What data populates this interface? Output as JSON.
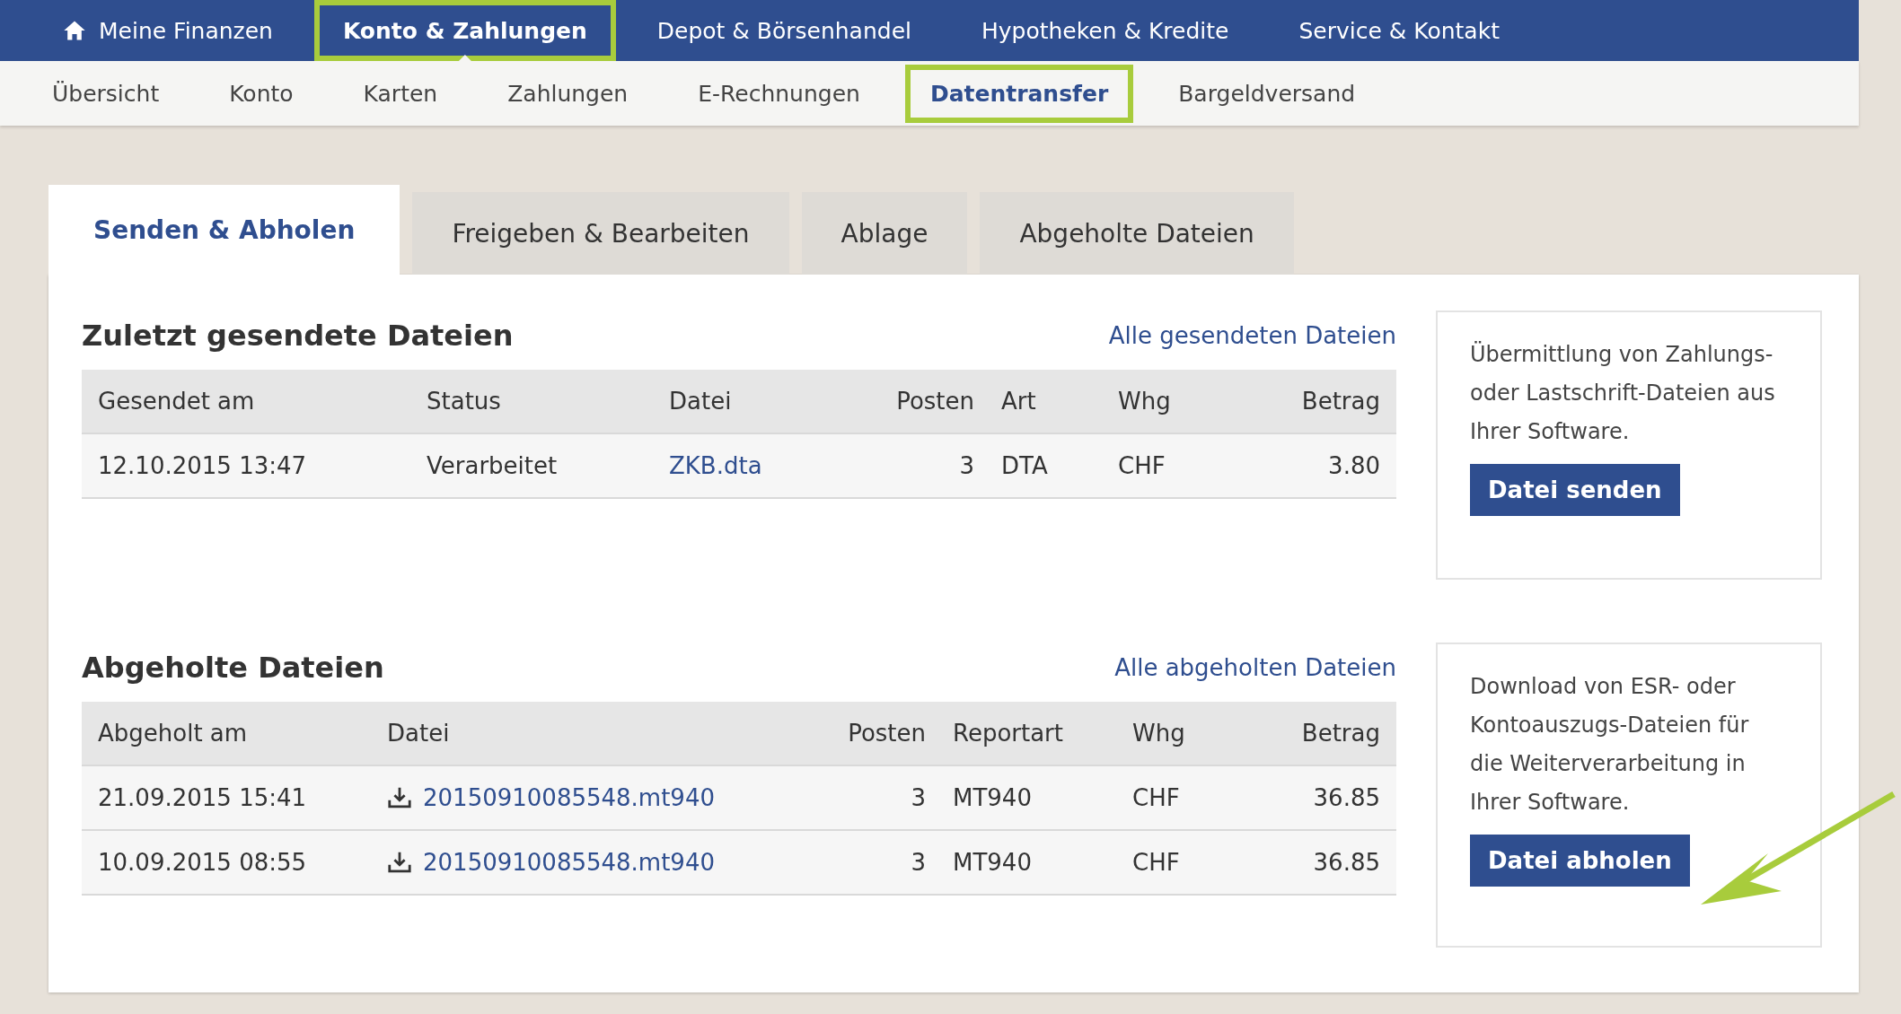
{
  "main_nav": [
    {
      "label": "Meine Finanzen",
      "kind": "home",
      "selected": false
    },
    {
      "label": "Konto & Zahlungen",
      "kind": "plain",
      "selected": true
    },
    {
      "label": "Depot & Börsenhandel",
      "kind": "plain",
      "selected": false
    },
    {
      "label": "Hypotheken & Kredite",
      "kind": "plain",
      "selected": false
    },
    {
      "label": "Service & Kontakt",
      "kind": "plain",
      "selected": false
    }
  ],
  "sub_nav": [
    {
      "label": "Übersicht",
      "selected": false
    },
    {
      "label": "Konto",
      "selected": false
    },
    {
      "label": "Karten",
      "selected": false
    },
    {
      "label": "Zahlungen",
      "selected": false
    },
    {
      "label": "E-Rechnungen",
      "selected": false
    },
    {
      "label": "Datentransfer",
      "selected": true
    },
    {
      "label": "Bargeldversand",
      "selected": false
    }
  ],
  "tabs": [
    {
      "label": "Senden & Abholen",
      "selected": true
    },
    {
      "label": "Freigeben & Bearbeiten",
      "selected": false
    },
    {
      "label": "Ablage",
      "selected": false
    },
    {
      "label": "Abgeholte Dateien",
      "selected": false
    }
  ],
  "sections": [
    {
      "title": "Zuletzt gesendete Dateien",
      "link": "Alle gesendeten Dateien",
      "columns": [
        {
          "label": "Gesendet am",
          "kind": "text"
        },
        {
          "label": "Status",
          "kind": "text"
        },
        {
          "label": "Datei",
          "kind": "link"
        },
        {
          "label": "Posten",
          "kind": "number"
        },
        {
          "label": "Art",
          "kind": "text"
        },
        {
          "label": "Whg",
          "kind": "text"
        },
        {
          "label": "Betrag",
          "kind": "number"
        }
      ],
      "rows": [
        [
          "12.10.2015 13:47",
          "Verarbeitet",
          "ZKB.dta",
          "3",
          "DTA",
          "CHF",
          "3.80"
        ]
      ],
      "side_text": "Übermittlung von Zahlungs- oder Lastschrift-Dateien aus Ihrer Software.",
      "side_button": "Datei senden"
    },
    {
      "title": "Abgeholte Dateien",
      "link": "Alle abgeholten Dateien",
      "columns": [
        {
          "label": "Abgeholt am",
          "kind": "text"
        },
        {
          "label": "Datei",
          "kind": "download"
        },
        {
          "label": "Posten",
          "kind": "number"
        },
        {
          "label": "Reportart",
          "kind": "text"
        },
        {
          "label": "Whg",
          "kind": "text"
        },
        {
          "label": "Betrag",
          "kind": "number"
        }
      ],
      "rows": [
        [
          "21.09.2015 15:41",
          "20150910085548.mt940",
          "3",
          "MT940",
          "CHF",
          "36.85"
        ],
        [
          "10.09.2015 08:55",
          "20150910085548.mt940",
          "3",
          "MT940",
          "CHF",
          "36.85"
        ]
      ],
      "side_text": "Download von ESR- oder Kontoauszugs-Dateien für die Weiterverarbeitung in Ihrer Software.",
      "side_button": "Datei abholen"
    }
  ]
}
